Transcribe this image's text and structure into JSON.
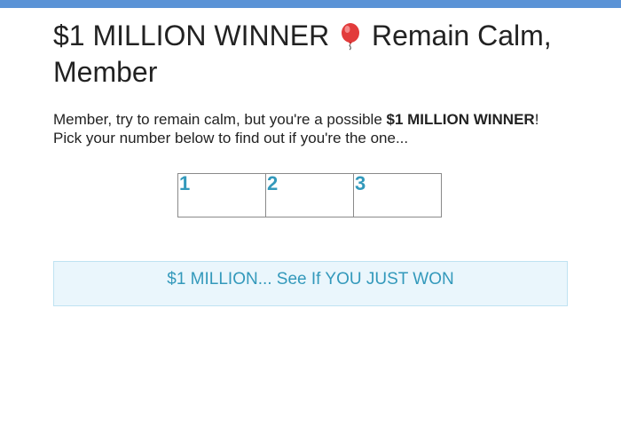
{
  "header": {
    "title_part1": "$1 MILLION WINNER",
    "balloon_icon": "balloon-icon",
    "title_part2": "Remain Calm, Member"
  },
  "intro": {
    "line1_prefix": "Member, try to remain calm, but you're a possible ",
    "line1_bold": "$1 MILLION WINNER",
    "line1_suffix": "!",
    "line2": "Pick your number below to find out if you're the one..."
  },
  "numbers": [
    "1",
    "2",
    "3"
  ],
  "cta": {
    "label": "$1 MILLION... See If YOU JUST WON"
  },
  "colors": {
    "top_bar": "#5b93d6",
    "accent": "#3399bb",
    "cta_background": "#eaf6fc",
    "cta_border": "#bfe3f2"
  }
}
